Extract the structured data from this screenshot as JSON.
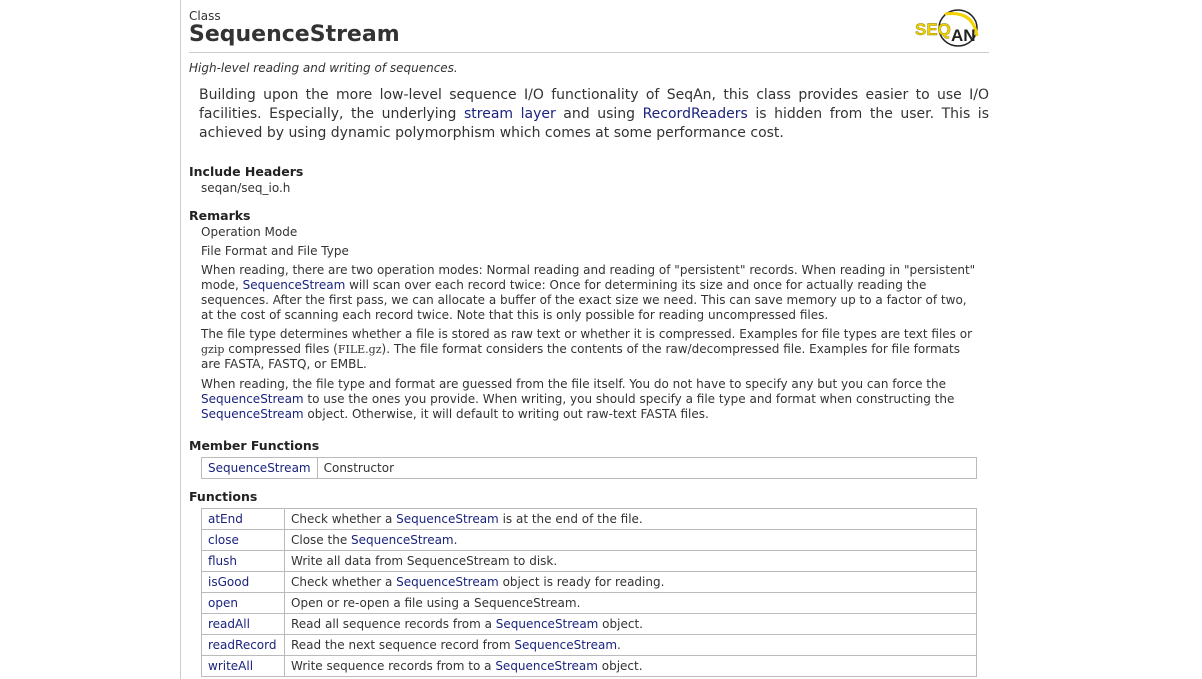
{
  "header": {
    "kind": "Class",
    "title": "SequenceStream",
    "logo_text": "SEQAN"
  },
  "summary": "High-level reading and writing of sequences.",
  "description": {
    "part1": "Building upon the more low-level sequence I/O functionality of SeqAn, this class provides easier to use I/O facilities. Especially, the underlying ",
    "link1": "stream layer",
    "part2": " and using ",
    "link2": "RecordReaders",
    "part3": " is hidden from the user. This is achieved by using dynamic polymorphism which comes at some performance cost."
  },
  "include_headers": {
    "title": "Include Headers",
    "items": [
      "seqan/seq_io.h"
    ]
  },
  "remarks": {
    "title": "Remarks",
    "items": [
      "Operation Mode",
      "File Format and File Type"
    ],
    "p1": {
      "a": "When reading, there are two operation modes: Normal reading and reading of \"persistent\" records. When reading in \"persistent\" mode, ",
      "link": "SequenceStream",
      "b": " will scan over each record twice: Once for determining its size and once for actually reading the sequences. After the first pass, we can allocate a buffer of the exact size we need. This can save memory up to a factor of two, at the cost of scanning each record twice. Note that this is only possible for reading uncompressed files."
    },
    "p2": {
      "a": "The file type determines whether a file is stored as raw text or whether it is compressed. Examples for file types are text files or ",
      "code1": "gzip",
      "b": " compressed files (",
      "code2": "FILE.gz",
      "c": "). The file format considers the contents of the raw/decompressed file. Examples for file formats are FASTA, FASTQ, or EMBL."
    },
    "p3": {
      "a": "When reading, the file type and format are guessed from the file itself. You do not have to specify any but you can force the ",
      "link1": "SequenceStream",
      "b": " to use the ones you provide. When writing, you should specify a file type and format when constructing the ",
      "link2": "SequenceStream",
      "c": " object. Otherwise, it will default to writing out raw-text FASTA files."
    }
  },
  "member_functions": {
    "title": "Member Functions",
    "rows": [
      {
        "name": "SequenceStream",
        "desc": "Constructor"
      }
    ]
  },
  "functions": {
    "title": "Functions",
    "rows": [
      {
        "name": "atEnd",
        "pre": "Check whether a ",
        "link": "SequenceStream",
        "post": " is at the end of the file."
      },
      {
        "name": "close",
        "pre": "Close the ",
        "link": "SequenceStream",
        "post": "."
      },
      {
        "name": "flush",
        "pre": "Write all data from SequenceStream to disk.",
        "link": "",
        "post": ""
      },
      {
        "name": "isGood",
        "pre": "Check whether a ",
        "link": "SequenceStream",
        "post": " object is ready for reading."
      },
      {
        "name": "open",
        "pre": "Open or re-open a file using a SequenceStream.",
        "link": "",
        "post": ""
      },
      {
        "name": "readAll",
        "pre": "Read all sequence records from a ",
        "link": "SequenceStream",
        "post": " object."
      },
      {
        "name": "readRecord",
        "pre": "Read the next sequence record from ",
        "link": "SequenceStream",
        "post": "."
      },
      {
        "name": "writeAll",
        "pre": "Write sequence records from to a ",
        "link": "SequenceStream",
        "post": " object."
      }
    ]
  },
  "colors": {
    "link": "#1a237e",
    "logo_yellow": "#f2d300",
    "text": "#333333",
    "border": "#bbbbbb"
  }
}
